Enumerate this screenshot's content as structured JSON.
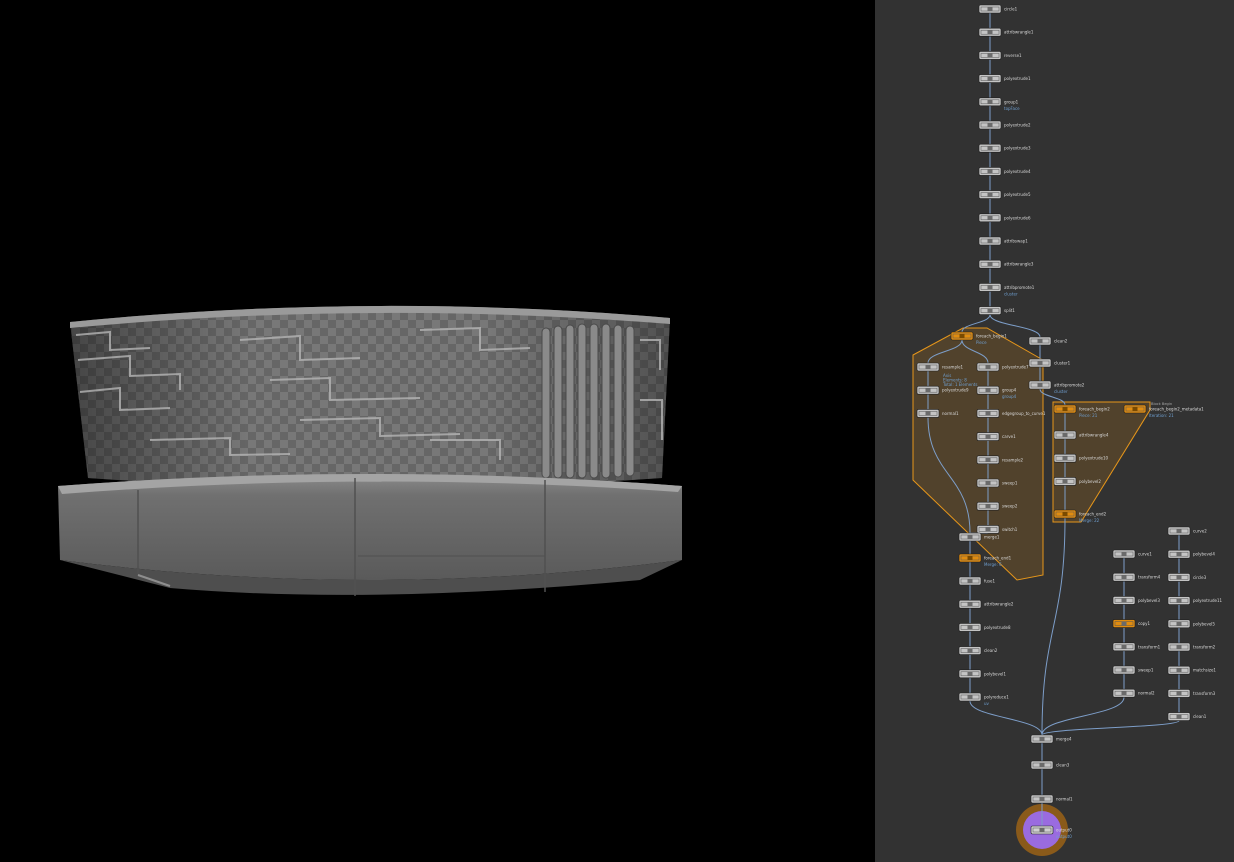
{
  "viewport": {
    "background": "#000000",
    "object": "cylindrical-panel-structure"
  },
  "network": {
    "background": "#323232",
    "colors": {
      "node": "#c4c4c4",
      "node_dark": "#8a8a8a",
      "wire": "#7d9ec9",
      "loop": "#e08c10",
      "loop_box": "#e6961a",
      "output": "#9a6be0",
      "flag": "#e0b020"
    },
    "main_chain": [
      {
        "label": "circle1"
      },
      {
        "label": "attribwrangle1"
      },
      {
        "label": "reverse1"
      },
      {
        "label": "polyextrude1"
      },
      {
        "label": "group1",
        "sub": "topFace"
      },
      {
        "label": "polyextrude2"
      },
      {
        "label": "polyextrude3"
      },
      {
        "label": "polyextrude4"
      },
      {
        "label": "polyextrude5"
      },
      {
        "label": "polyextrude6"
      },
      {
        "label": "attribswap1"
      },
      {
        "label": "attribwrangle3"
      },
      {
        "label": "attribpromote1",
        "sub": "cluster"
      },
      {
        "label": "split1"
      }
    ],
    "loop1": {
      "begin": "foreach_begin1",
      "begin_sub": "Piece",
      "end": "foreach_end1",
      "end_sub": "Merge: 6",
      "left": [
        {
          "label": "resample1"
        },
        {
          "label": "polyextrude9"
        },
        {
          "label": "normal1"
        }
      ],
      "left_note": [
        "Axis",
        "Elements: 8",
        "Total: 1 Elements"
      ],
      "right": [
        {
          "label": "polyextrude7"
        },
        {
          "label": "group4",
          "sub": "group4"
        },
        {
          "label": "edgegroup_to_curve1"
        },
        {
          "label": "carve1"
        },
        {
          "label": "resample2"
        },
        {
          "label": "sweep1"
        },
        {
          "label": "sweep2"
        },
        {
          "label": "switch1"
        }
      ],
      "merge": "merge1"
    },
    "after_loop1": [
      {
        "label": "fuse1"
      },
      {
        "label": "attribwrangle2"
      },
      {
        "label": "polyextrude8"
      },
      {
        "label": "clean2"
      },
      {
        "label": "polybevel1"
      },
      {
        "label": "polyreduce1",
        "sub": "uv"
      }
    ],
    "side_chain": [
      {
        "label": "clean2"
      },
      {
        "label": "cluster1"
      },
      {
        "label": "attribpromote2",
        "sub": "cluster"
      }
    ],
    "loop2": {
      "begin": "foreach_begin2",
      "begin_sub": "Piece: 21",
      "meta": "foreach_begin2_metadata1",
      "meta_sub": "Iteration: 21",
      "block_tag": "Block Begin",
      "end": "foreach_end2",
      "end_sub": "Merge: 22",
      "inner": [
        {
          "label": "attribwrangle4"
        },
        {
          "label": "polyextrude10"
        },
        {
          "label": "polybevel2"
        }
      ]
    },
    "column3": [
      {
        "label": "curve1"
      },
      {
        "label": "transform4"
      },
      {
        "label": "polybevel3"
      },
      {
        "label": "copy1"
      },
      {
        "label": "transform1"
      },
      {
        "label": "sweep1"
      },
      {
        "label": "normal2"
      }
    ],
    "column4": [
      {
        "label": "curve2"
      },
      {
        "label": "polybevel4"
      },
      {
        "label": "circle3"
      },
      {
        "label": "polyextrude11"
      },
      {
        "label": "polybevel5"
      },
      {
        "label": "transform2"
      },
      {
        "label": "matchsize1"
      },
      {
        "label": "transform3"
      },
      {
        "label": "clean1"
      }
    ],
    "output_chain": [
      {
        "label": "merge4"
      },
      {
        "label": "clean3"
      },
      {
        "label": "normal1"
      },
      {
        "label": "output0",
        "sub": "output0"
      }
    ]
  }
}
